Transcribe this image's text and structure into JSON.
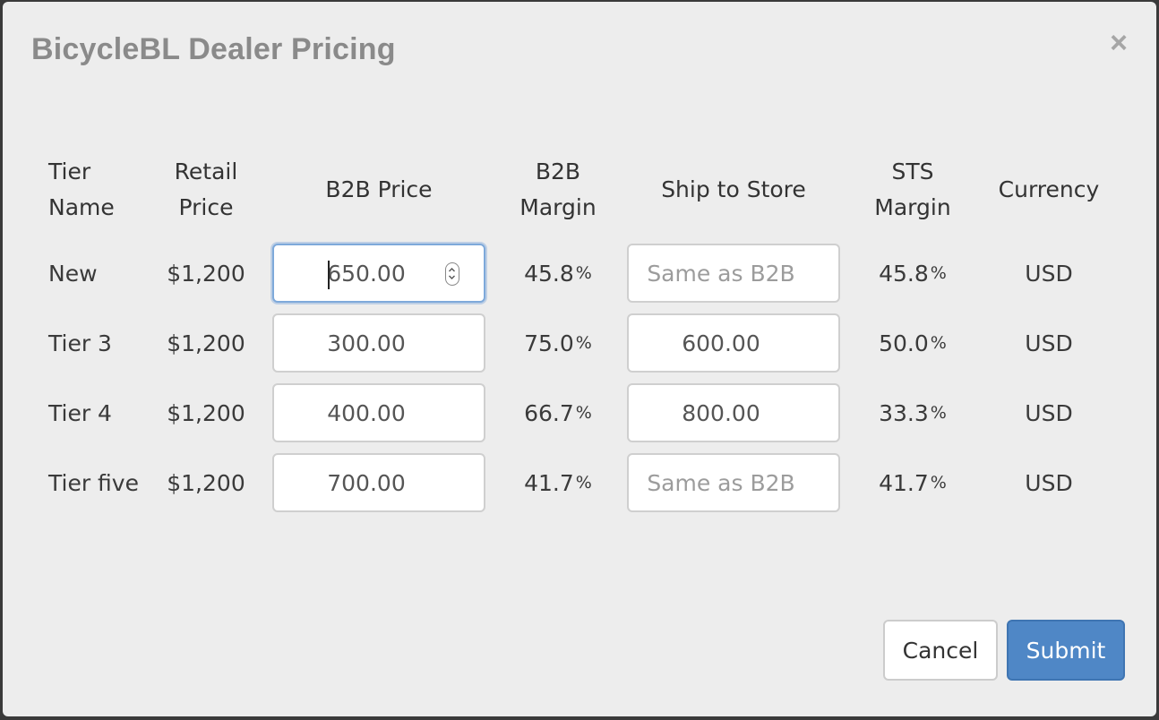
{
  "modal": {
    "title": "BicycleBL Dealer Pricing",
    "close_label": "×"
  },
  "columns": [
    {
      "line1": "Tier",
      "line2": "Name"
    },
    {
      "line1": "Retail",
      "line2": "Price"
    },
    {
      "line1": "B2B Price",
      "line2": ""
    },
    {
      "line1": "B2B",
      "line2": "Margin"
    },
    {
      "line1": "Ship to Store",
      "line2": ""
    },
    {
      "line1": "STS",
      "line2": "Margin"
    },
    {
      "line1": "Currency",
      "line2": ""
    }
  ],
  "rows": [
    {
      "tier_name": "New",
      "retail_price": "$1,200",
      "b2b_price": "650.00",
      "b2b_margin": "45.8",
      "ship_to_store": "",
      "ship_to_store_placeholder": "Same as B2B",
      "sts_margin": "45.8",
      "currency": "USD"
    },
    {
      "tier_name": "Tier 3",
      "retail_price": "$1,200",
      "b2b_price": "300.00",
      "b2b_margin": "75.0",
      "ship_to_store": "600.00",
      "ship_to_store_placeholder": "Same as B2B",
      "sts_margin": "50.0",
      "currency": "USD"
    },
    {
      "tier_name": "Tier 4",
      "retail_price": "$1,200",
      "b2b_price": "400.00",
      "b2b_margin": "66.7",
      "ship_to_store": "800.00",
      "ship_to_store_placeholder": "Same as B2B",
      "sts_margin": "33.3",
      "currency": "USD"
    },
    {
      "tier_name": "Tier five",
      "retail_price": "$1,200",
      "b2b_price": "700.00",
      "b2b_margin": "41.7",
      "ship_to_store": "",
      "ship_to_store_placeholder": "Same as B2B",
      "sts_margin": "41.7",
      "currency": "USD"
    }
  ],
  "percent_sign": "%",
  "buttons": {
    "cancel_label": "Cancel",
    "submit_label": "Submit"
  },
  "colors": {
    "accent": "#4f87c6",
    "focus_ring": "#7ea9da",
    "title": "#8a8a8a"
  }
}
